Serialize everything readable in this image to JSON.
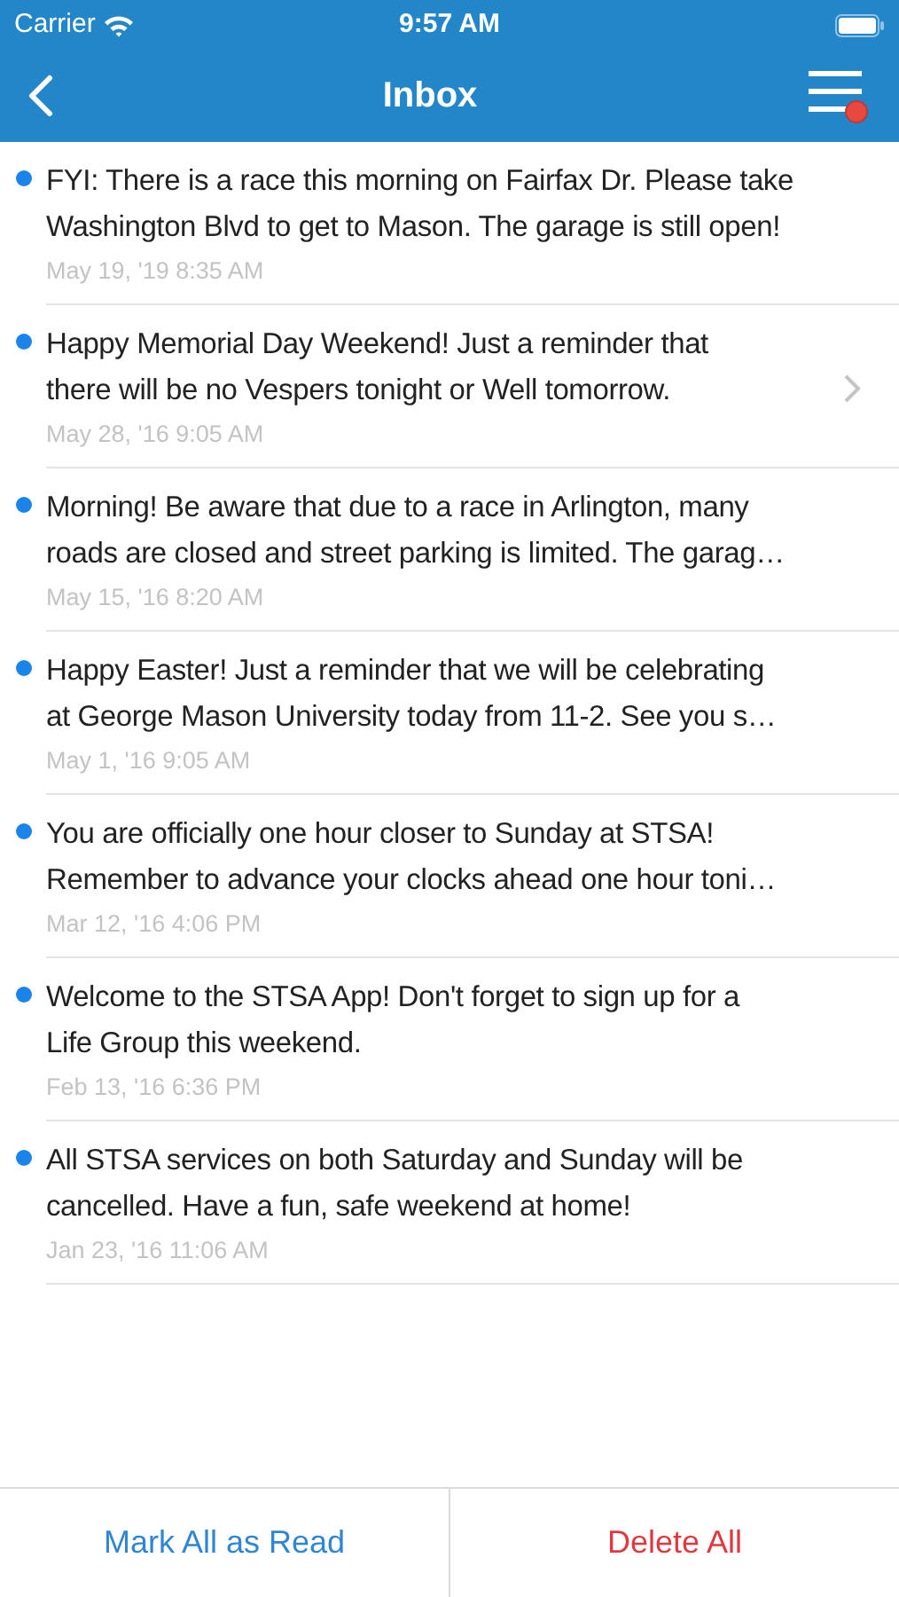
{
  "status_bar": {
    "carrier": "Carrier",
    "time": "9:57 AM"
  },
  "nav_bar": {
    "title": "Inbox",
    "menu_badge": true
  },
  "messages": [
    {
      "lines": [
        "FYI: There is a race this morning on Fairfax Dr. Please take",
        "Washington Blvd to get to Mason. The garage is still open!"
      ],
      "date": "May 19, '19 8:35 AM",
      "unread": true,
      "chevron": false
    },
    {
      "lines": [
        "Happy Memorial Day Weekend! Just a reminder that",
        "there will be no Vespers tonight or Well tomorrow."
      ],
      "date": "May 28, '16 9:05 AM",
      "unread": true,
      "chevron": true
    },
    {
      "lines": [
        "Morning! Be aware that due to a race in Arlington, many",
        "roads are closed and street parking is limited. The garag…"
      ],
      "date": "May 15, '16 8:20 AM",
      "unread": true,
      "chevron": false
    },
    {
      "lines": [
        "Happy Easter! Just a reminder that we will be celebrating",
        "at George Mason University today from 11-2.  See you s…"
      ],
      "date": "May 1, '16 9:05 AM",
      "unread": true,
      "chevron": false
    },
    {
      "lines": [
        "You are officially one hour closer to Sunday at STSA!",
        "Remember to advance your clocks ahead one hour toni…"
      ],
      "date": "Mar 12, '16 4:06 PM",
      "unread": true,
      "chevron": false
    },
    {
      "lines": [
        "Welcome to the STSA App! Don't forget to sign up for a",
        "Life Group this weekend."
      ],
      "date": "Feb 13, '16 6:36 PM",
      "unread": true,
      "chevron": false
    },
    {
      "lines": [
        "All STSA services on both Saturday and Sunday will be",
        "cancelled. Have a fun, safe weekend at home!"
      ],
      "date": "Jan 23, '16 11:06 AM",
      "unread": true,
      "chevron": false
    }
  ],
  "actions": [
    {
      "label": "Mark All as Read",
      "kind": "primary"
    },
    {
      "label": "Delete All",
      "kind": "danger"
    }
  ]
}
